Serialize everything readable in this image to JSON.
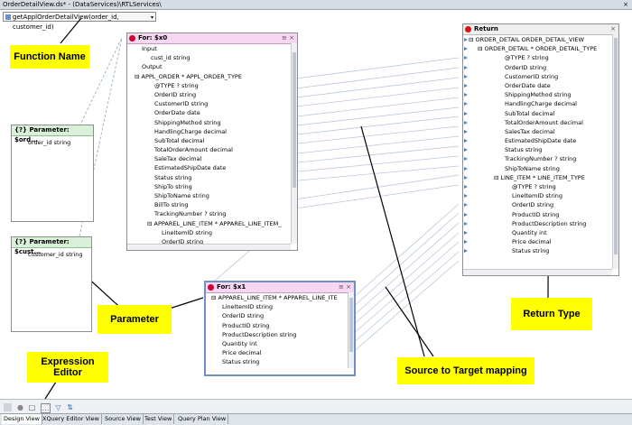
{
  "title": {
    "text": "OrderDetailView.ds* - (DataServices)\\RTLServices\\",
    "close": "×"
  },
  "function_selector": {
    "value": "getApplOrderDetailView(order_id, customer_id)",
    "dropdown": "▾"
  },
  "param_order": {
    "title": "{?} Parameter: $ord...",
    "item": "order_id string"
  },
  "param_cust": {
    "title": "{?} Parameter: $cust...",
    "item": "customer_id string"
  },
  "for_x0": {
    "title": "For: $x0",
    "controls": "≡ ×",
    "rows": [
      "Input",
      "cust_id string",
      "Output",
      "⊟ APPL_ORDER * APPL_ORDER_TYPE",
      "@TYPE ? string",
      "OrderID string",
      "CustomerID string",
      "OrderDate date",
      "ShippingMethod string",
      "HandlingCharge decimal",
      "SubTotal decimal",
      "TotalOrderAmount decimal",
      "SaleTax decimal",
      "EstimatedShipDate date",
      "Status string",
      "ShipTo string",
      "ShipToName string",
      "BillTo string",
      "TrackingNumber ? string",
      "⊟ APPAREL_LINE_ITEM * APPAREL_LINE_ITEM_",
      "LineItemID string",
      "OrderID string"
    ]
  },
  "for_x1": {
    "title": "For: $x1",
    "controls": "≡ ×",
    "rows": [
      "⊟ APPAREL_LINE_ITEM * APPAREL_LINE_ITE",
      "LineItemID string",
      "OrderID string",
      "ProductID string",
      "ProductDescription string",
      "Quantity int",
      "Price decimal",
      "Status string"
    ]
  },
  "return": {
    "title": "Return",
    "close": "×",
    "rows": [
      "⊟ ORDER_DETAIL ORDER_DETAIL_VIEW",
      "⊟ ORDER_DETAIL * ORDER_DETAIL_TYPE",
      "@TYPE ? string",
      "OrderID string",
      "CustomerID string",
      "OrderDate date",
      "ShippingMethod string",
      "HandlingCharge decimal",
      "SubTotal decimal",
      "TotalOrderAmount decimal",
      "SalesTax decimal",
      "EstimatedShipDate date",
      "Status string",
      "TrackingNumber ? string",
      "ShipToName string",
      "⊟ LINE_ITEM * LINE_ITEM_TYPE",
      "@TYPE ? string",
      "LineItemID string",
      "OrderID string",
      "ProductID string",
      "ProductDescription string",
      "Quantity int",
      "Price decimal",
      "Status string"
    ]
  },
  "callouts": {
    "function_name": "Function Name",
    "parameter": "Parameter",
    "expression_editor": "Expression Editor",
    "source_to_target": "Source to Target mapping",
    "return_type": "Return Type"
  },
  "tabs": [
    "Design View",
    "XQuery Editor View",
    "Source View",
    "Test View",
    "Query Plan View"
  ],
  "colors": {
    "pink_header": "#f6d6f0",
    "green_header": "#d9f0d9",
    "callout": "#ffff00",
    "port": "#4f7fb7",
    "link": "#b9c7d8"
  }
}
